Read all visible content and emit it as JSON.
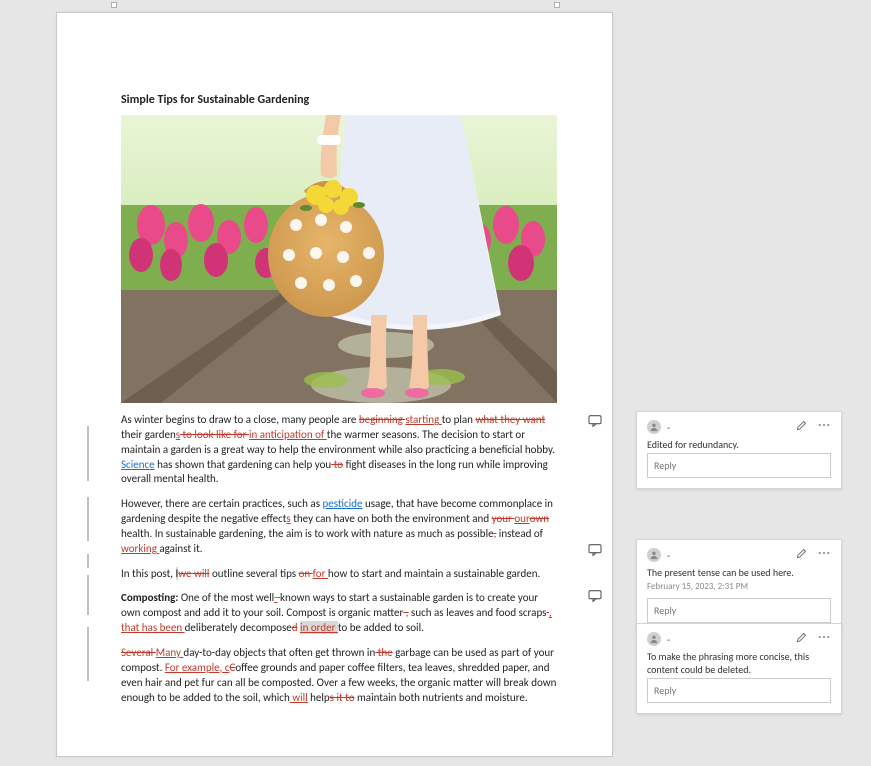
{
  "document": {
    "title": "Simple Tips for Sustainable Gardening",
    "paragraphs": {
      "p1_a": "As winter begins to draw to a close, many people are ",
      "p1_del1": "beginning ",
      "p1_ins1": "starting ",
      "p1_b": "to plan ",
      "p1_del2": "what they want ",
      "p1_c": "their garden",
      "p1_ins2": "s",
      "p1_del3": " to look like for ",
      "p1_ins3": "in anticipation of ",
      "p1_d": "the warmer seasons. The decision to start or maintain a garden is a great way to help the environment while also practicing a beneficial hobby. ",
      "p1_link": "Science",
      "p1_e": " has shown that gardening can help you",
      "p1_del4": " to",
      "p1_f": " fight diseases in the long run while improving overall mental health.",
      "p2_a": "However, there are certain practices, such as ",
      "p2_link": "pesticide",
      "p2_b": " usage, that have become commonplace in gardening despite the negative effect",
      "p2_ins1": "s",
      "p2_c": " they can have on both the environment and ",
      "p2_del1": "your ",
      "p2_ins2": "our",
      "p2_del2": "own",
      "p2_d": " health. In sustainable gardening, the aim is to work with nature as much as possible",
      "p2_del3": ",",
      "p2_e": " instead of ",
      "p2_ins3": "working ",
      "p2_f": "against it.",
      "p3_a": "In this post, ",
      "p3_ins1": "I",
      "p3_del1": "we will",
      "p3_b": " outline several tips ",
      "p3_del2": "on ",
      "p3_ins2": "for ",
      "p3_c": "how to start and maintain a sustainable garden.",
      "p4_label": "Composting:",
      "p4_a": " One of the most well",
      "p4_ins1": "-",
      "p4_del1": " ",
      "p4_b": "known ways to start a sustainable garden is to create your own compost and add it to your soil. Compost is organic matter",
      "p4_del2": " ,",
      "p4_c": " such as leaves and food scraps",
      "p4_del3": " ",
      "p4_ins2": ", that has been ",
      "p4_d": "deliberately decompose",
      "p4_del4": "d",
      "p4_e": " ",
      "p4_ins3": "in order ",
      "p4_f": "to be added to soil.",
      "p5_del1": "Several ",
      "p5_ins1": "Many ",
      "p5_a": "day-to-day objects that often get thrown in",
      "p5_del2": " the",
      "p5_b": " garbage can be used as part of your compost. ",
      "p5_ins2": "For example, c",
      "p5_del3": "C",
      "p5_c": "offee grounds and paper coffee filters, tea leaves, shredded paper, and even hair and pet fur can all be composted. Over a few weeks, the organic matter will break down enough to be added to the soil, which",
      "p5_ins3": " will",
      "p5_d": " help",
      "p5_del4": "s it to",
      "p5_e": " maintain both nutrients and moisture."
    }
  },
  "comments": [
    {
      "author": "-",
      "text": "Edited for redundancy.",
      "time": "",
      "reply_placeholder": "Reply"
    },
    {
      "author": "-",
      "text": "The present tense can be used here.",
      "time": "February 15, 2023, 2:31 PM",
      "reply_placeholder": "Reply"
    },
    {
      "author": "-",
      "text": "To make the phrasing more concise, this content could be deleted.",
      "time": "",
      "reply_placeholder": "Reply"
    }
  ]
}
